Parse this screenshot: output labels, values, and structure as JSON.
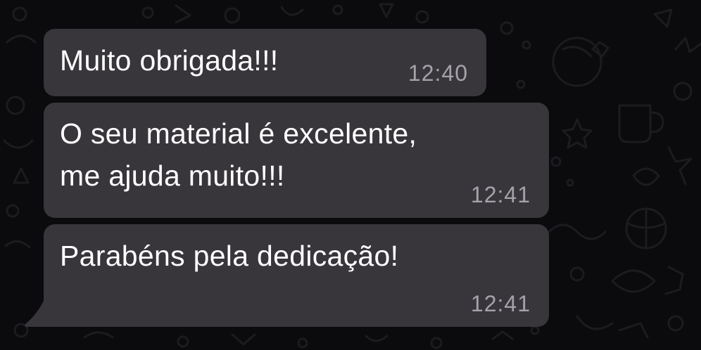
{
  "messages": [
    {
      "text": "Muito obrigada!!!",
      "time": "12:40"
    },
    {
      "lines": [
        "O seu material é excelente,",
        "me ajuda muito!!!"
      ],
      "time": "12:41"
    },
    {
      "text": "Parabéns pela dedicação!",
      "time": "12:41"
    }
  ],
  "colors": {
    "background": "#0b0a0c",
    "bubble": "#38353b",
    "text": "#ffffff",
    "timestamp": "#a6a2a9"
  }
}
